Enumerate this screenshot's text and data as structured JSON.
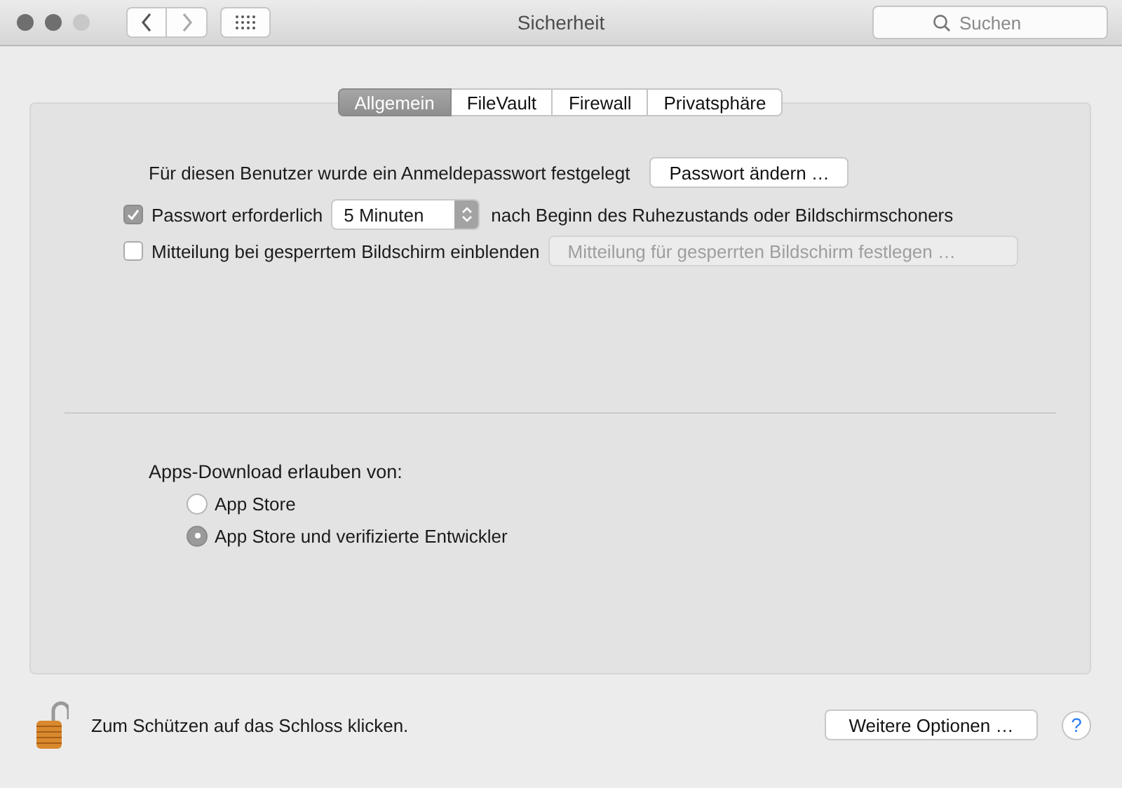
{
  "window": {
    "title": "Sicherheit"
  },
  "toolbar": {
    "search": {
      "placeholder": "Suchen"
    }
  },
  "tabs": [
    {
      "label": "Allgemein",
      "selected": true
    },
    {
      "label": "FileVault",
      "selected": false
    },
    {
      "label": "Firewall",
      "selected": false
    },
    {
      "label": "Privatsphäre",
      "selected": false
    }
  ],
  "password": {
    "text": "Für diesen Benutzer wurde ein Anmeldepasswort festgelegt",
    "button": "Passwort ändern …"
  },
  "require": {
    "label": "Passwort erforderlich",
    "checked": true,
    "delay": "5 Minuten",
    "suffix": "nach Beginn des Ruhezustands oder Bildschirmschoners"
  },
  "lock_message": {
    "label": "Mitteilung bei gesperrtem Bildschirm einblenden",
    "checked": false,
    "button": "Mitteilung für gesperrten Bildschirm festlegen …",
    "button_disabled": true
  },
  "downloads": {
    "label": "Apps-Download erlauben von:",
    "options": [
      {
        "label": "App Store",
        "selected": false
      },
      {
        "label": "App Store und verifizierte Entwickler",
        "selected": true
      }
    ]
  },
  "footer": {
    "locked": false,
    "text": "Zum Schützen auf das Schloss klicken.",
    "button": "Weitere Optionen …",
    "help": "?"
  }
}
